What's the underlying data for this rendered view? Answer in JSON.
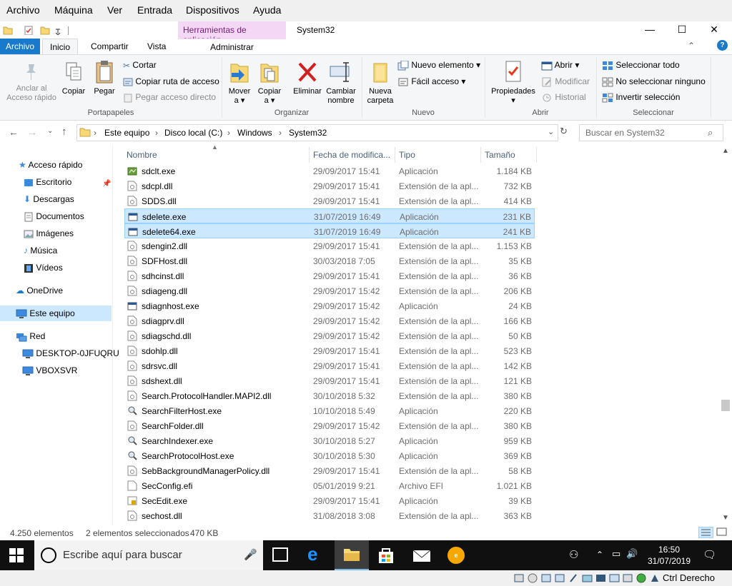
{
  "vbox_menu": [
    "Archivo",
    "Máquina",
    "Ver",
    "Entrada",
    "Dispositivos",
    "Ayuda"
  ],
  "title": {
    "context_tab": "Herramientas de aplicación",
    "window_title": "System32",
    "minimize": "—",
    "maximize": "☐",
    "close": "✕"
  },
  "tabs": {
    "archivo": "Archivo",
    "inicio": "Inicio",
    "compartir": "Compartir",
    "vista": "Vista",
    "administrar": "Administrar"
  },
  "ribbon": {
    "portapapeles": {
      "label": "Portapapeles",
      "anclar_1": "Anclar al",
      "anclar_2": "Acceso rápido",
      "copiar": "Copiar",
      "pegar": "Pegar",
      "cortar": "Cortar",
      "copiar_ruta": "Copiar ruta de acceso",
      "pegar_acceso": "Pegar acceso directo"
    },
    "organizar": {
      "label": "Organizar",
      "mover_1": "Mover",
      "mover_2": "a ▾",
      "copiar_1": "Copiar",
      "copiar_2": "a ▾",
      "eliminar": "Eliminar",
      "cambiar_1": "Cambiar",
      "cambiar_2": "nombre"
    },
    "nuevo": {
      "label": "Nuevo",
      "nueva_1": "Nueva",
      "nueva_2": "carpeta",
      "nuevo_elemento": "Nuevo elemento ▾",
      "facil_acceso": "Fácil acceso ▾"
    },
    "abrir": {
      "label": "Abrir",
      "propiedades": "Propiedades",
      "abrir": "Abrir ▾",
      "modificar": "Modificar",
      "historial": "Historial"
    },
    "seleccionar": {
      "label": "Seleccionar",
      "todo": "Seleccionar todo",
      "ninguno": "No seleccionar ninguno",
      "invertir": "Invertir selección"
    }
  },
  "address": {
    "crumbs": [
      "Este equipo",
      "Disco local (C:)",
      "Windows",
      "System32"
    ],
    "search_placeholder": "Buscar en System32"
  },
  "nav": {
    "acceso_rapido": "Acceso rápido",
    "escritorio": "Escritorio",
    "descargas": "Descargas",
    "documentos": "Documentos",
    "imagenes": "Imágenes",
    "musica": "Música",
    "videos": "Vídeos",
    "onedrive": "OneDrive",
    "este_equipo": "Este equipo",
    "red": "Red",
    "desktop": "DESKTOP-0JFUQRU",
    "vboxsvr": "VBOXSVR"
  },
  "columns": {
    "name": "Nombre",
    "date": "Fecha de modifica...",
    "type": "Tipo",
    "size": "Tamaño"
  },
  "files": [
    {
      "name": "sdclt.exe",
      "date": "29/09/2017 15:41",
      "type": "Aplicación",
      "size": "1.184 KB",
      "icon": "exe-green",
      "selected": false
    },
    {
      "name": "sdcpl.dll",
      "date": "29/09/2017 15:41",
      "type": "Extensión de la apl...",
      "size": "732 KB",
      "icon": "dll",
      "selected": false
    },
    {
      "name": "SDDS.dll",
      "date": "29/09/2017 15:41",
      "type": "Extensión de la apl...",
      "size": "414 KB",
      "icon": "dll",
      "selected": false
    },
    {
      "name": "sdelete.exe",
      "date": "31/07/2019 16:49",
      "type": "Aplicación",
      "size": "231 KB",
      "icon": "exe",
      "selected": true
    },
    {
      "name": "sdelete64.exe",
      "date": "31/07/2019 16:49",
      "type": "Aplicación",
      "size": "241 KB",
      "icon": "exe",
      "selected": true
    },
    {
      "name": "sdengin2.dll",
      "date": "29/09/2017 15:41",
      "type": "Extensión de la apl...",
      "size": "1.153 KB",
      "icon": "dll",
      "selected": false
    },
    {
      "name": "SDFHost.dll",
      "date": "30/03/2018 7:05",
      "type": "Extensión de la apl...",
      "size": "35 KB",
      "icon": "dll",
      "selected": false
    },
    {
      "name": "sdhcinst.dll",
      "date": "29/09/2017 15:41",
      "type": "Extensión de la apl...",
      "size": "36 KB",
      "icon": "dll",
      "selected": false
    },
    {
      "name": "sdiageng.dll",
      "date": "29/09/2017 15:42",
      "type": "Extensión de la apl...",
      "size": "206 KB",
      "icon": "dll",
      "selected": false
    },
    {
      "name": "sdiagnhost.exe",
      "date": "29/09/2017 15:42",
      "type": "Aplicación",
      "size": "24 KB",
      "icon": "exe",
      "selected": false
    },
    {
      "name": "sdiagprv.dll",
      "date": "29/09/2017 15:42",
      "type": "Extensión de la apl...",
      "size": "166 KB",
      "icon": "dll",
      "selected": false
    },
    {
      "name": "sdiagschd.dll",
      "date": "29/09/2017 15:42",
      "type": "Extensión de la apl...",
      "size": "50 KB",
      "icon": "dll",
      "selected": false
    },
    {
      "name": "sdohlp.dll",
      "date": "29/09/2017 15:41",
      "type": "Extensión de la apl...",
      "size": "523 KB",
      "icon": "dll",
      "selected": false
    },
    {
      "name": "sdrsvc.dll",
      "date": "29/09/2017 15:41",
      "type": "Extensión de la apl...",
      "size": "142 KB",
      "icon": "dll",
      "selected": false
    },
    {
      "name": "sdshext.dll",
      "date": "29/09/2017 15:41",
      "type": "Extensión de la apl...",
      "size": "121 KB",
      "icon": "dll",
      "selected": false
    },
    {
      "name": "Search.ProtocolHandler.MAPI2.dll",
      "date": "30/10/2018 5:32",
      "type": "Extensión de la apl...",
      "size": "380 KB",
      "icon": "dll",
      "selected": false
    },
    {
      "name": "SearchFilterHost.exe",
      "date": "10/10/2018 5:49",
      "type": "Aplicación",
      "size": "220 KB",
      "icon": "exe-search",
      "selected": false
    },
    {
      "name": "SearchFolder.dll",
      "date": "29/09/2017 15:42",
      "type": "Extensión de la apl...",
      "size": "380 KB",
      "icon": "dll",
      "selected": false
    },
    {
      "name": "SearchIndexer.exe",
      "date": "30/10/2018 5:27",
      "type": "Aplicación",
      "size": "959 KB",
      "icon": "exe-search",
      "selected": false
    },
    {
      "name": "SearchProtocolHost.exe",
      "date": "30/10/2018 5:30",
      "type": "Aplicación",
      "size": "369 KB",
      "icon": "exe-search",
      "selected": false
    },
    {
      "name": "SebBackgroundManagerPolicy.dll",
      "date": "29/09/2017 15:41",
      "type": "Extensión de la apl...",
      "size": "58 KB",
      "icon": "dll",
      "selected": false
    },
    {
      "name": "SecConfig.efi",
      "date": "05/01/2019 9:21",
      "type": "Archivo EFI",
      "size": "1.021 KB",
      "icon": "file",
      "selected": false
    },
    {
      "name": "SecEdit.exe",
      "date": "29/09/2017 15:41",
      "type": "Aplicación",
      "size": "39 KB",
      "icon": "exe-lock",
      "selected": false
    },
    {
      "name": "sechost.dll",
      "date": "31/08/2018 3:08",
      "type": "Extensión de la apl...",
      "size": "363 KB",
      "icon": "dll",
      "selected": false
    }
  ],
  "status": {
    "count": "4.250 elementos",
    "selected": "2 elementos seleccionados",
    "size": "470 KB"
  },
  "taskbar": {
    "search_placeholder": "Escribe aquí para buscar",
    "time": "16:50",
    "date": "31/07/2019"
  },
  "vbox_status": {
    "host_key": "Ctrl Derecho"
  },
  "colors": {
    "accent": "#1979ca",
    "selection": "#cce8ff",
    "context_tab": "#f4d7f4"
  }
}
